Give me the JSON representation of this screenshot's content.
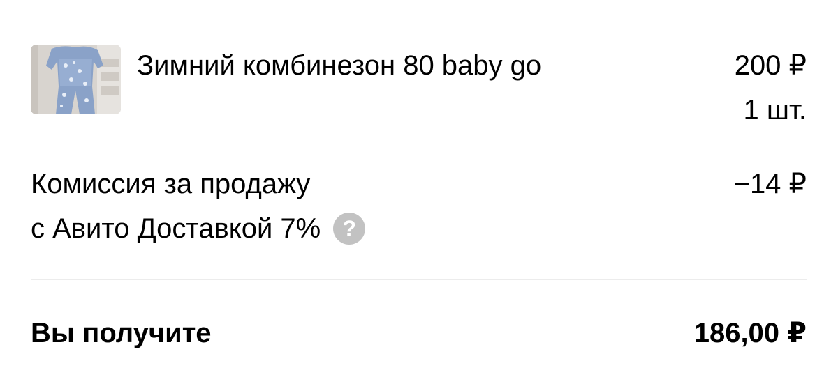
{
  "item": {
    "title": "Зимний комбинезон 80 baby go",
    "price": "200 ₽",
    "quantity": "1 шт.",
    "thumbnail_icon": "product-photo"
  },
  "fee": {
    "label_line1": "Комиссия за продажу",
    "label_line2": "с Авито Доставкой 7%",
    "amount": "−14 ₽",
    "help_icon": "question-mark-icon",
    "help_glyph": "?"
  },
  "total": {
    "label": "Вы получите",
    "amount": "186,00 ₽"
  },
  "colors": {
    "text": "#000000",
    "divider": "#ececec",
    "help_icon_bg": "#c2c2c2"
  }
}
